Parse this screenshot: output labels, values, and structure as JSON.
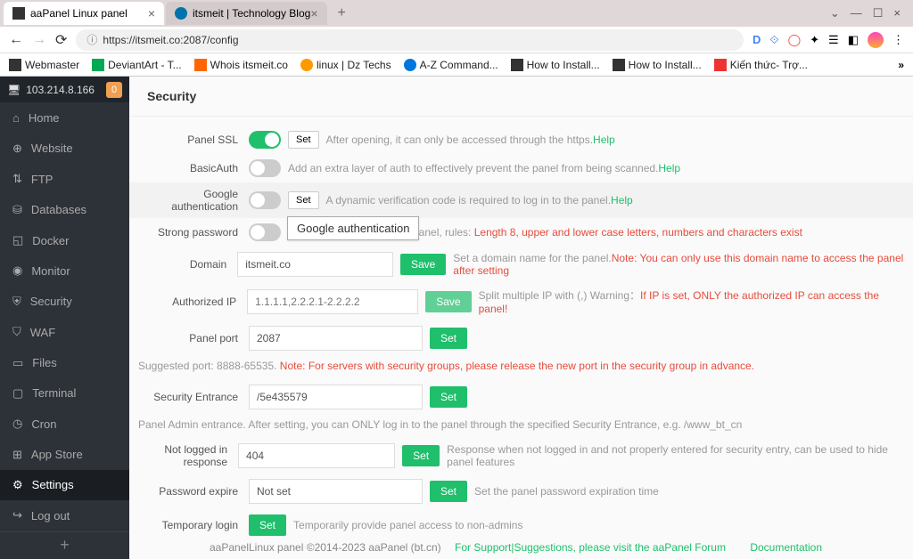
{
  "browser": {
    "tabs": [
      {
        "title": "aaPanel Linux panel",
        "icon": "bt"
      },
      {
        "title": "itsmeit | Technology Blog",
        "icon": "wp"
      }
    ],
    "url": "https://itsmeit.co:2087/config",
    "bookmarks": [
      "Webmaster",
      "DeviantArt - T...",
      "Whois itsmeit.co",
      "linux | Dz Techs",
      "A-Z Command...",
      "How to Install...",
      "How to Install...",
      "Kiến thức- Trợ..."
    ],
    "more": "»"
  },
  "sidebar": {
    "ip": "103.214.8.166",
    "badge": "0",
    "items": [
      "Home",
      "Website",
      "FTP",
      "Databases",
      "Docker",
      "Monitor",
      "Security",
      "WAF",
      "Files",
      "Terminal",
      "Cron",
      "App Store",
      "Settings",
      "Log out"
    ]
  },
  "page": {
    "title": "Security",
    "tooltip": "Google authentication",
    "rows": {
      "panel_ssl": {
        "label": "Panel SSL",
        "set": "Set",
        "hint": "After opening, it can only be accessed through the https.",
        "help": "Help"
      },
      "basic_auth": {
        "label": "BasicAuth",
        "hint": "Add an extra layer of auth to effectively prevent the panel from being scanned.",
        "help": "Help"
      },
      "google_auth": {
        "label": "Google authentication",
        "set": "Set",
        "hint": "A dynamic verification code is required to log in to the panel.",
        "help": "Help"
      },
      "strong_pw": {
        "label": "Strong password",
        "hint_pre": "e panel, rules: ",
        "hint_warn": "Length 8, upper and lower case letters, numbers and characters exist"
      },
      "domain": {
        "label": "Domain",
        "value": "itsmeit.co",
        "save": "Save",
        "hint": "Set a domain name for the panel.",
        "warn": "Note: You can only use this domain name to access the panel after setting"
      },
      "auth_ip": {
        "label": "Authorized IP",
        "placeholder": "1.1.1.1,2.2.2.1-2.2.2.2",
        "save": "Save",
        "hint": "Split multiple IP with (,) Warning：",
        "warn": "If IP is set, ONLY the authorized IP can access the panel!"
      },
      "port": {
        "label": "Panel port",
        "value": "2087",
        "set": "Set"
      },
      "port_note": {
        "pre": "Suggested port: 8888-65535. ",
        "warn": "Note: For servers with security groups, please release the new port in the security group in advance."
      },
      "entrance": {
        "label": "Security Entrance",
        "value": "/5e435579",
        "set": "Set"
      },
      "entrance_note": "Panel Admin entrance. After setting, you can ONLY log in to the panel through the specified Security Entrance, e.g. /www_bt_cn",
      "not_logged": {
        "label": "Not logged in response",
        "value": "404",
        "set": "Set",
        "hint": "Response when not logged in and not properly entered for security entry, can be used to hide panel features"
      },
      "pw_expire": {
        "label": "Password expire",
        "value": "Not set",
        "set": "Set",
        "hint": "Set the panel password expiration time"
      },
      "temp_login": {
        "label": "Temporary login",
        "set": "Set",
        "hint": "Temporarily provide panel access to non-admins"
      }
    }
  },
  "footer": {
    "copyright": "aaPanelLinux panel ©2014-2023 aaPanel (bt.cn)",
    "support": "For Support|Suggestions, please visit the aaPanel Forum",
    "docs": "Documentation"
  }
}
